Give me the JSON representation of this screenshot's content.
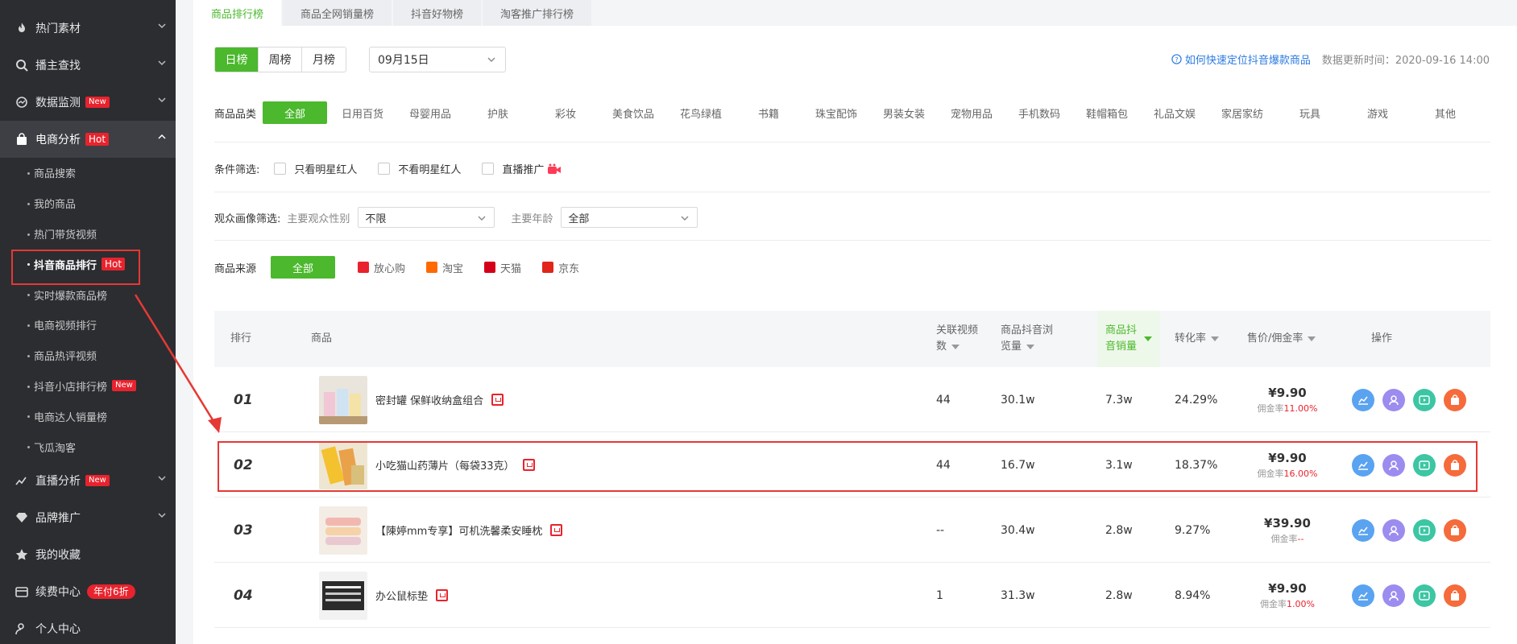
{
  "sidebar": {
    "groups": [
      {
        "label": "热门素材",
        "icon": "fire-icon"
      },
      {
        "label": "播主查找",
        "icon": "search-icon"
      },
      {
        "label": "数据监测",
        "icon": "monitor-icon",
        "badge": "New"
      },
      {
        "label": "电商分析",
        "icon": "shopping-bag-icon",
        "badge": "Hot"
      }
    ],
    "sub_items": [
      "商品搜索",
      "我的商品",
      "热门带货视频",
      "抖音商品排行",
      "实时爆款商品榜",
      "电商视频排行",
      "商品热评视频",
      "抖音小店排行榜",
      "电商达人销量榜",
      "飞瓜淘客"
    ],
    "current_badge": "Hot",
    "shop_rank_badge": "New",
    "lower_groups": [
      {
        "label": "直播分析",
        "icon": "live-chart-icon",
        "badge": "New"
      },
      {
        "label": "品牌推广",
        "icon": "diamond-icon"
      },
      {
        "label": "我的收藏",
        "icon": "star-icon"
      },
      {
        "label": "续费中心",
        "icon": "wallet-icon",
        "badge": "年付6折"
      },
      {
        "label": "个人中心",
        "icon": "user-icon"
      }
    ]
  },
  "tabs": [
    "商品排行榜",
    "商品全网销量榜",
    "抖音好物榜",
    "淘客推广排行榜"
  ],
  "period": {
    "options": [
      "日榜",
      "周榜",
      "月榜"
    ],
    "date": "09月15日"
  },
  "help_text": "如何快速定位抖音爆款商品",
  "updated_text": "数据更新时间：2020-09-16 14:00",
  "category": {
    "label": "商品品类",
    "all": "全部",
    "items": [
      "日用百货",
      "母婴用品",
      "护肤",
      "彩妆",
      "美食饮品",
      "花鸟绿植",
      "书籍",
      "珠宝配饰",
      "男装女装",
      "宠物用品",
      "手机数码",
      "鞋帽箱包",
      "礼品文娱",
      "家居家纺",
      "玩具",
      "游戏",
      "其他"
    ]
  },
  "conditions": {
    "label": "条件筛选:",
    "options": [
      "只看明星红人",
      "不看明星红人",
      "直播推广"
    ]
  },
  "audience": {
    "label": "观众画像筛选:",
    "gender_label": "主要观众性别",
    "gender_value": "不限",
    "age_label": "主要年龄",
    "age_value": "全部"
  },
  "source": {
    "label": "商品来源",
    "all": "全部",
    "items": [
      {
        "name": "放心购",
        "color": "#e8232d"
      },
      {
        "name": "淘宝",
        "color": "#ff6a00"
      },
      {
        "name": "天猫",
        "color": "#d4001a"
      },
      {
        "name": "京东",
        "color": "#e1251b"
      }
    ]
  },
  "table": {
    "headers": {
      "rank": "排行",
      "product": "商品",
      "videos": "关联视频数",
      "views": "商品抖音浏览量",
      "sales": "商品抖音销量",
      "conversion": "转化率",
      "price": "售价/佣金率",
      "ops": "操作"
    },
    "commission_label": "佣金率",
    "rows": [
      {
        "rank": "01",
        "name": "密封罐 保鲜收纳盒组合",
        "videos": "44",
        "views": "30.1w",
        "sales": "7.3w",
        "conversion": "24.29%",
        "price": "¥9.90",
        "commission": "11.00%"
      },
      {
        "rank": "02",
        "name": "小吃猫山药薄片（每袋33克）",
        "videos": "44",
        "views": "16.7w",
        "sales": "3.1w",
        "conversion": "18.37%",
        "price": "¥9.90",
        "commission": "16.00%"
      },
      {
        "rank": "03",
        "name": "【陳婷mm专享】可机洗馨柔安睡枕",
        "videos": "--",
        "views": "30.4w",
        "sales": "2.8w",
        "conversion": "9.27%",
        "price": "¥39.90",
        "commission": "--"
      },
      {
        "rank": "04",
        "name": "办公鼠标垫",
        "videos": "1",
        "views": "31.3w",
        "sales": "2.8w",
        "conversion": "8.94%",
        "price": "¥9.90",
        "commission": "1.00%"
      }
    ]
  },
  "colors": {
    "accent": "#4bb82d",
    "hot": "#e8232d",
    "sidebar": "#2b2d31"
  }
}
